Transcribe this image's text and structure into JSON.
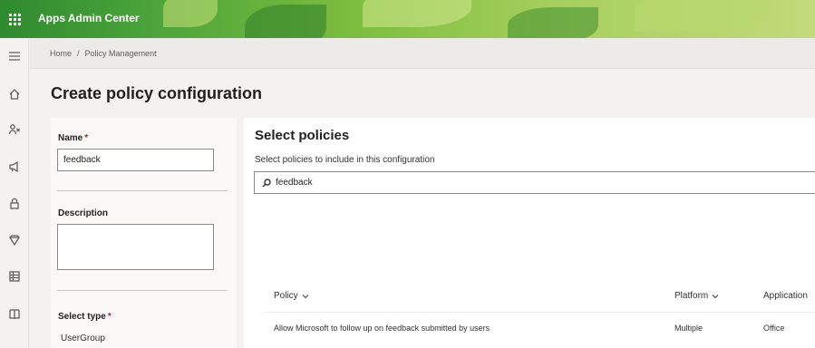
{
  "header": {
    "app_title": "Apps Admin Center"
  },
  "breadcrumb": {
    "items": [
      "Home",
      "/",
      "Policy Management"
    ]
  },
  "page": {
    "title": "Create policy configuration"
  },
  "form": {
    "name_label": "Name",
    "required_mark": "*",
    "name_value": "feedback",
    "description_label": "Description",
    "description_value": "",
    "type_label": "Select type",
    "type_value": "UserGroup"
  },
  "policies": {
    "title": "Select policies",
    "subtitle": "Select policies to include in this configuration",
    "search_value": "feedback",
    "columns": [
      "Policy",
      "Platform",
      "Application"
    ],
    "rows": [
      {
        "policy": "Allow Microsoft to follow up on feedback submitted by users",
        "platform": "Multiple",
        "application": "Office"
      }
    ]
  },
  "nav_icons": [
    "menu-icon",
    "home-icon",
    "users-icon",
    "megaphone-icon",
    "lock-icon",
    "shield-icon",
    "grid-icon",
    "book-icon"
  ]
}
